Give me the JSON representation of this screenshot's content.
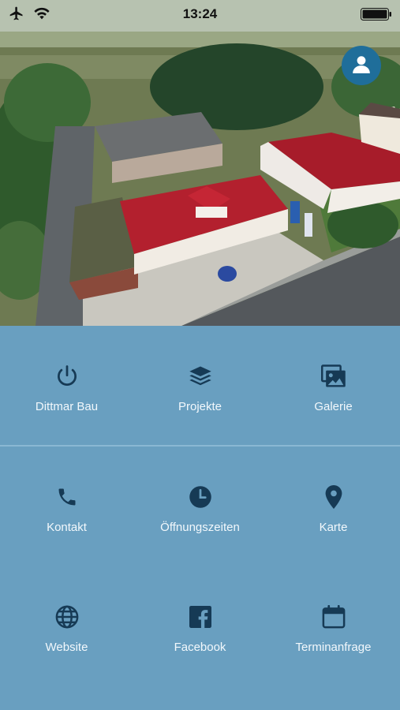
{
  "status_bar": {
    "time": "13:24"
  },
  "menu": {
    "row1": [
      {
        "label": "Dittmar Bau",
        "icon": "power-icon"
      },
      {
        "label": "Projekte",
        "icon": "layers-icon"
      },
      {
        "label": "Galerie",
        "icon": "gallery-icon"
      }
    ],
    "row2": [
      {
        "label": "Kontakt",
        "icon": "phone-icon"
      },
      {
        "label": "Öffnungszeiten",
        "icon": "clock-icon"
      },
      {
        "label": "Karte",
        "icon": "map-pin-icon"
      }
    ],
    "row3": [
      {
        "label": "Website",
        "icon": "globe-icon"
      },
      {
        "label": "Facebook",
        "icon": "facebook-icon"
      },
      {
        "label": "Terminanfrage",
        "icon": "calendar-icon"
      }
    ]
  },
  "colors": {
    "menu_bg": "#699fc0",
    "icon": "#163a55",
    "label": "#f2f8fc",
    "profile_btn": "#1f6e9a"
  }
}
